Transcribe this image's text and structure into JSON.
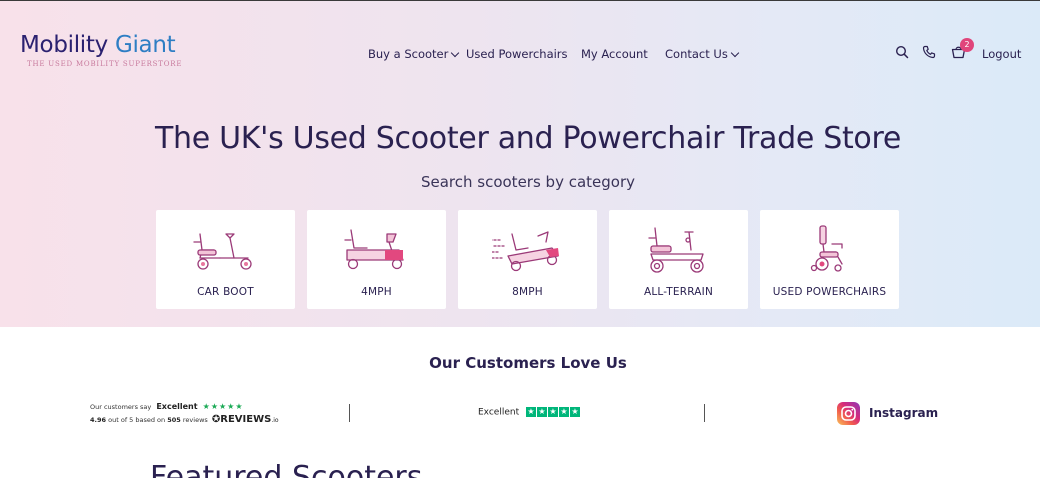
{
  "header": {
    "logo_word1": "Mobility",
    "logo_word2": "Giant",
    "logo_tagline": "THE USED MOBILITY SUPERSTORE",
    "nav": [
      {
        "label": "Buy a Scooter",
        "has_dropdown": true
      },
      {
        "label": "Used Powerchairs",
        "has_dropdown": false
      },
      {
        "label": "My Account",
        "has_dropdown": false
      },
      {
        "label": "Contact Us",
        "has_dropdown": true
      }
    ],
    "icons": [
      "search-icon",
      "phone-icon",
      "basket-icon"
    ],
    "cart_count": "2",
    "logout_label": "Logout"
  },
  "hero": {
    "title": "The UK's Used Scooter and Powerchair Trade Store",
    "subtitle": "Search scooters by category",
    "categories": [
      {
        "label": "CAR BOOT",
        "icon": "car-boot-scooter-icon"
      },
      {
        "label": "4MPH",
        "icon": "4mph-scooter-icon"
      },
      {
        "label": "8MPH",
        "icon": "8mph-scooter-icon"
      },
      {
        "label": "ALL-TERRAIN",
        "icon": "all-terrain-scooter-icon"
      },
      {
        "label": "USED POWERCHAIRS",
        "icon": "powerchair-icon"
      }
    ]
  },
  "reviews": {
    "section_title": "Our Customers Love Us",
    "reviewsio": {
      "line1_prefix": "Our customers say",
      "rating_word": "Excellent",
      "score": "4.96",
      "line2_mid": "out of 5 based on",
      "count": "505",
      "line2_suffix": "reviews",
      "brand": "REVIEWS",
      "brand_suffix": ".io"
    },
    "trustpilot": {
      "rating_word": "Excellent"
    },
    "instagram": {
      "label": "Instagram"
    }
  },
  "featured": {
    "title": "Featured Scooters"
  },
  "colors": {
    "brand_navy": "#2b2170",
    "brand_blue": "#2e7ec4",
    "accent_pink": "#e0457b",
    "trustpilot_green": "#00b67a"
  }
}
